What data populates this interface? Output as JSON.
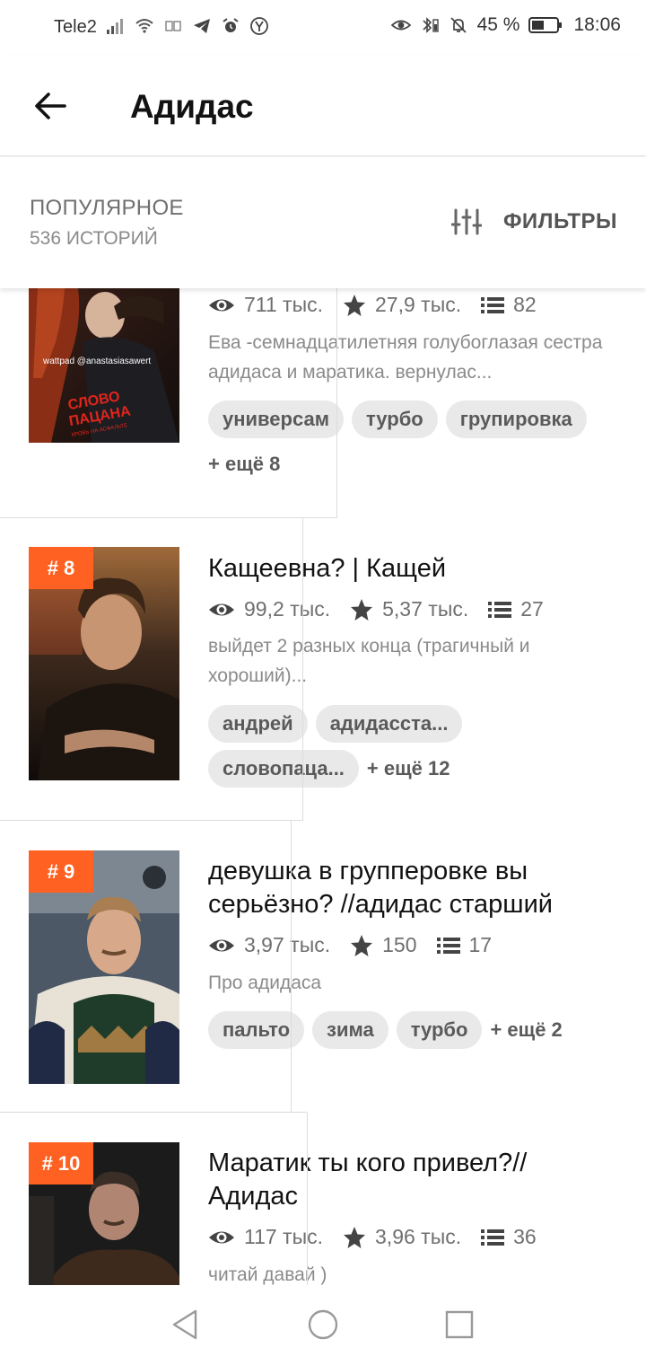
{
  "status_bar": {
    "carrier": "Tele2",
    "battery": "45 %",
    "time": "18:06"
  },
  "header": {
    "title": "Адидас"
  },
  "filter_bar": {
    "sort_label": "ПОПУЛЯРНОЕ",
    "count_label": "536 ИСТОРИЙ",
    "filters_label": "ФИЛЬТРЫ"
  },
  "stories": [
    {
      "views": "711 тыс.",
      "votes": "27,9 тыс.",
      "parts": "82",
      "description": "Ева -семнадцатилетняя голубоглазая сестра адидаса и маратика. вернулас...",
      "tags": [
        "универсам",
        "турбо",
        "групировка"
      ],
      "more_tags": "+ ещё 8",
      "cover_text": {
        "watermark": "wattpad @anastasiasawert",
        "title_line_1": "СЛОВО",
        "title_line_2": "ПАЦАНА",
        "subtitle": "КРОВЬ НА АСФАЛЬТЕ"
      }
    },
    {
      "rank": "# 8",
      "title": "Кащеевна? | Кащей",
      "views": "99,2 тыс.",
      "votes": "5,37 тыс.",
      "parts": "27",
      "description": "выйдет 2 разных конца (трагичный и хороший)...",
      "tags": [
        "андрей",
        "адидасста...",
        "словопаца..."
      ],
      "more_tags": "+ ещё 12"
    },
    {
      "rank": "# 9",
      "title": "девушка в групперовке вы серьёзно? //адидас старший",
      "views": "3,97 тыс.",
      "votes": "150",
      "parts": "17",
      "description": "Про адидаса",
      "tags": [
        "пальто",
        "зима",
        "турбо"
      ],
      "more_tags": "+ ещё 2"
    },
    {
      "rank": "# 10",
      "title": "Маратик ты кого привел?// Адидас",
      "views": "117 тыс.",
      "votes": "3,96 тыс.",
      "parts": "36",
      "description": "читай давай )"
    }
  ],
  "icons": {
    "views": "eye-icon",
    "votes": "star-icon",
    "parts": "list-icon",
    "filters": "sliders-icon"
  },
  "colors": {
    "accent": "#ff6122",
    "tag_bg": "#e9e9e9",
    "meta_text": "#6f6f6f"
  }
}
